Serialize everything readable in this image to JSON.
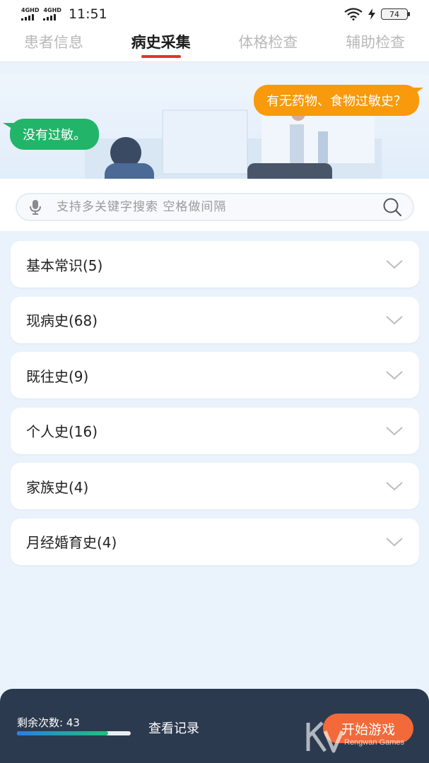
{
  "status_bar": {
    "network_1": "4GHD",
    "network_2": "4GHD",
    "time": "11:51",
    "battery": "74"
  },
  "tabs": [
    {
      "label": "患者信息",
      "active": false
    },
    {
      "label": "病史采集",
      "active": true
    },
    {
      "label": "体格检查",
      "active": false
    },
    {
      "label": "辅助检查",
      "active": false
    }
  ],
  "banner": {
    "question_bubble": "有无药物、食物过敏史？",
    "answer_bubble": "没有过敏。"
  },
  "search": {
    "placeholder": "支持多关键字搜索 空格做间隔",
    "value": ""
  },
  "sections": [
    {
      "label": "基本常识(5)"
    },
    {
      "label": "现病史(68)"
    },
    {
      "label": "既往史(9)"
    },
    {
      "label": "个人史(16)"
    },
    {
      "label": "家族史(4)"
    },
    {
      "label": "月经婚育史(4)"
    }
  ],
  "bottom_bar": {
    "remaining_label": "剩余次数: 43",
    "remaining_progress_fraction": 0.8,
    "history_button": "查看记录",
    "start_button": "开始游戏",
    "watermark_sub": "Rengwan Games"
  },
  "colors": {
    "tab_indicator": "#e5322d",
    "question_bubble": "#f89a0c",
    "answer_bubble": "#22b56a",
    "bottom_bar": "#2c3a4f",
    "start_button": "#f26a3a"
  }
}
